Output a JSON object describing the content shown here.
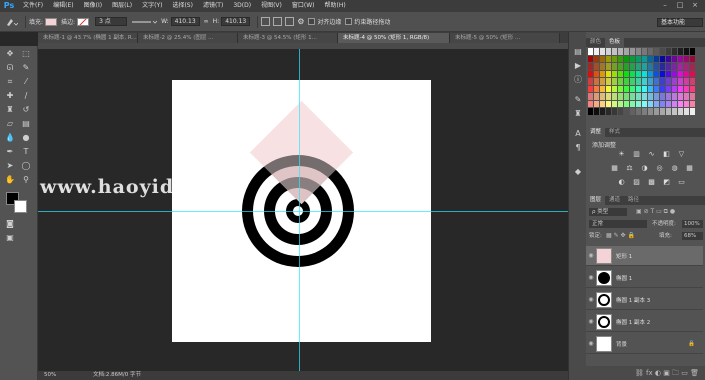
{
  "app": {
    "logo": "Ps"
  },
  "menu": [
    "文件(F)",
    "编辑(E)",
    "图像(I)",
    "图层(L)",
    "文字(Y)",
    "选择(S)",
    "滤镜(T)",
    "3D(D)",
    "视图(V)",
    "窗口(W)",
    "帮助(H)"
  ],
  "options": {
    "fill_label": "填充:",
    "fill_color": "#f3d3d6",
    "stroke_label": "描边:",
    "stroke_size": "3 点",
    "w_label": "W:",
    "w_value": "410.13",
    "h_label": "H:",
    "h_value": "410.13",
    "align_edges": "对齐边缘",
    "constrain_path": "约束路径拖动",
    "workspace": "基本功能"
  },
  "tabs": [
    "未标题-1 @ 43.7% (椭圆 1 副本, R...",
    "未标题-2 @ 25.4% (图层 ...",
    "未标题-3 @ 54.5% (矩形 1...",
    "未标题-4 @ 50% (矩形 1, RGB/8)",
    "未标题-5 @ 50% (矩形 ..."
  ],
  "active_tab_index": 3,
  "status": {
    "zoom": "50%",
    "doc": "文档:2.86M/0 字节"
  },
  "watermark": "www.haoyidian",
  "swatches_panel": {
    "tabs": [
      "颜色",
      "色板"
    ]
  },
  "adjust_panel": {
    "tabs": [
      "调整",
      "样式"
    ],
    "title": "添加调整"
  },
  "layers_panel": {
    "tabs": [
      "图层",
      "通道",
      "路径"
    ],
    "kind": "ρ 类型",
    "blend": "正常",
    "opacity_label": "不透明度:",
    "opacity": "100%",
    "lock_label": "锁定:",
    "fill_label": "填充:",
    "fill": "68%",
    "layers": [
      {
        "name": "矩形 1",
        "thumb": "rect",
        "selected": true
      },
      {
        "name": "椭圆 1",
        "thumb": "ellipse-black",
        "selected": false
      },
      {
        "name": "椭圆 1 副本 3",
        "thumb": "ellipse-ring",
        "selected": false
      },
      {
        "name": "椭圆 1 副本 2",
        "thumb": "ellipse-ring",
        "selected": false
      },
      {
        "name": "背景",
        "thumb": "white",
        "selected": false
      }
    ]
  },
  "colors": {
    "accent": "#31a8ff",
    "guide": "#2ee6ff",
    "pink": "#f3d3d6"
  }
}
